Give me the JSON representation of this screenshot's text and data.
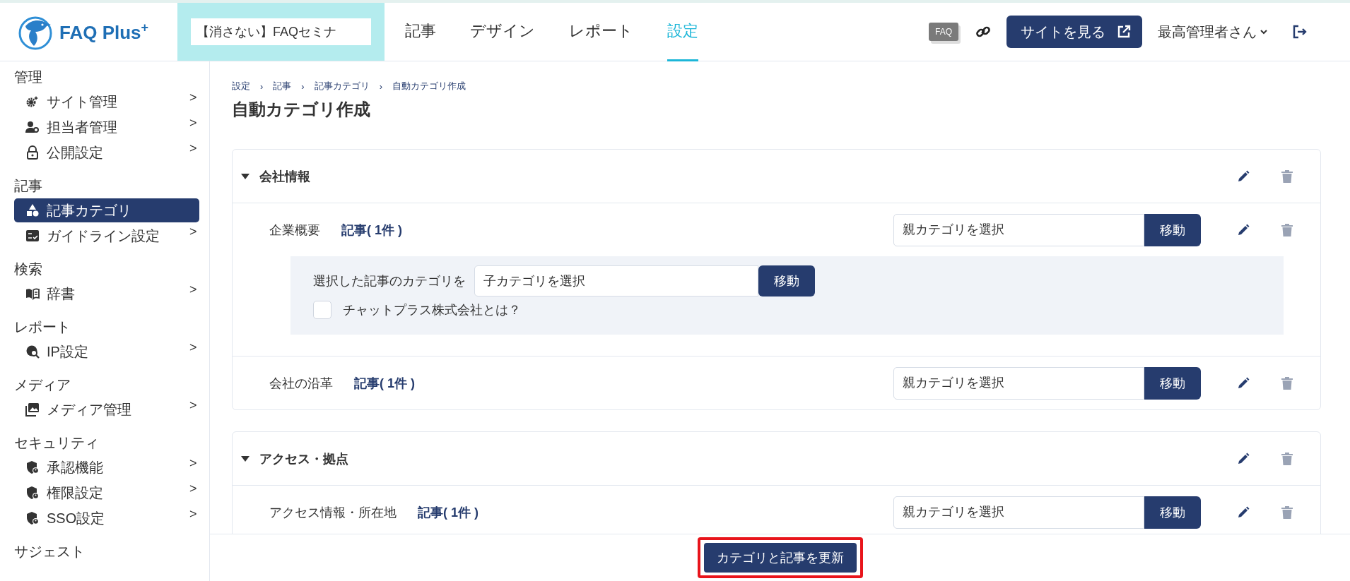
{
  "header": {
    "logo": "FAQ Plus$^{+}$",
    "project_selector": {
      "value": "【消さない】FAQセミナ"
    },
    "faq_badge": "FAQ",
    "view_site_button": "サイトを見る",
    "user_menu": "最高管理者さん"
  },
  "nav": {
    "tabs": [
      {
        "label": "記事",
        "selected": false
      },
      {
        "label": "デザイン",
        "selected": false
      },
      {
        "label": "レポート",
        "selected": false
      },
      {
        "label": "設定",
        "selected": true
      }
    ]
  },
  "sidebar": {
    "sections": [
      {
        "title": "管理",
        "items": [
          {
            "label": "サイト管理",
            "selected": false,
            "arrow": ">"
          },
          {
            "label": "担当者管理",
            "selected": false,
            "arrow": ">"
          },
          {
            "label": "公開設定",
            "selected": false,
            "arrow": ">"
          }
        ]
      },
      {
        "title": "記事",
        "items": [
          {
            "label": "記事カテゴリ",
            "selected": true
          },
          {
            "label": "ガイドライン設定",
            "selected": false,
            "arrow": ">"
          }
        ]
      },
      {
        "title": "検索",
        "items": [
          {
            "label": "辞書",
            "selected": false,
            "arrow": ">"
          }
        ]
      },
      {
        "title": "レポート",
        "items": [
          {
            "label": "IP設定",
            "selected": false,
            "arrow": ">"
          }
        ]
      },
      {
        "title": "メディア",
        "items": [
          {
            "label": "メディア管理",
            "selected": false,
            "arrow": ">"
          }
        ]
      },
      {
        "title": "セキュリティ",
        "items": [
          {
            "label": "承認機能",
            "selected": false,
            "arrow": ">"
          },
          {
            "label": "権限設定",
            "selected": false,
            "arrow": ">"
          },
          {
            "label": "SSO設定",
            "selected": false,
            "arrow": ">"
          }
        ]
      },
      {
        "title": "サジェスト"
      }
    ]
  },
  "breadcrumb": [
    {
      "label": "設定"
    },
    {
      "separator": "›",
      "label": "記事"
    },
    {
      "separator": "›",
      "label": "記事カテゴリ"
    },
    {
      "separator": "›",
      "label": "自動カテゴリ作成"
    }
  ],
  "page_title": "自動カテゴリ作成",
  "categories": [
    {
      "name": "会社情報",
      "expanded": true,
      "articles": [
        {
          "name": "企業概要",
          "count": "記事( 1件 )",
          "parent_placeholder": "親カテゴリを選択",
          "move": "移動",
          "expanded": true,
          "panel": {
            "label": "選択した記事のカテゴリを",
            "child_placeholder": "子カテゴリを選択",
            "move": "移動",
            "items": [
              {
                "label": "チャットプラス株式会社とは？",
                "checked": false
              }
            ]
          }
        },
        {
          "name": "会社の沿革",
          "count": "記事( 1件 )",
          "parent_placeholder": "親カテゴリを選択",
          "move": "移動",
          "expanded": false
        }
      ]
    },
    {
      "name": "アクセス・拠点",
      "expanded": true,
      "articles": [
        {
          "name": "アクセス情報・所在地",
          "count": "記事( 1件 )",
          "parent_placeholder": "親カテゴリを選択",
          "move": "移動",
          "expanded": false
        }
      ]
    }
  ],
  "footer": {
    "update_button": "カテゴリと記事を更新",
    "highlighted": true
  }
}
